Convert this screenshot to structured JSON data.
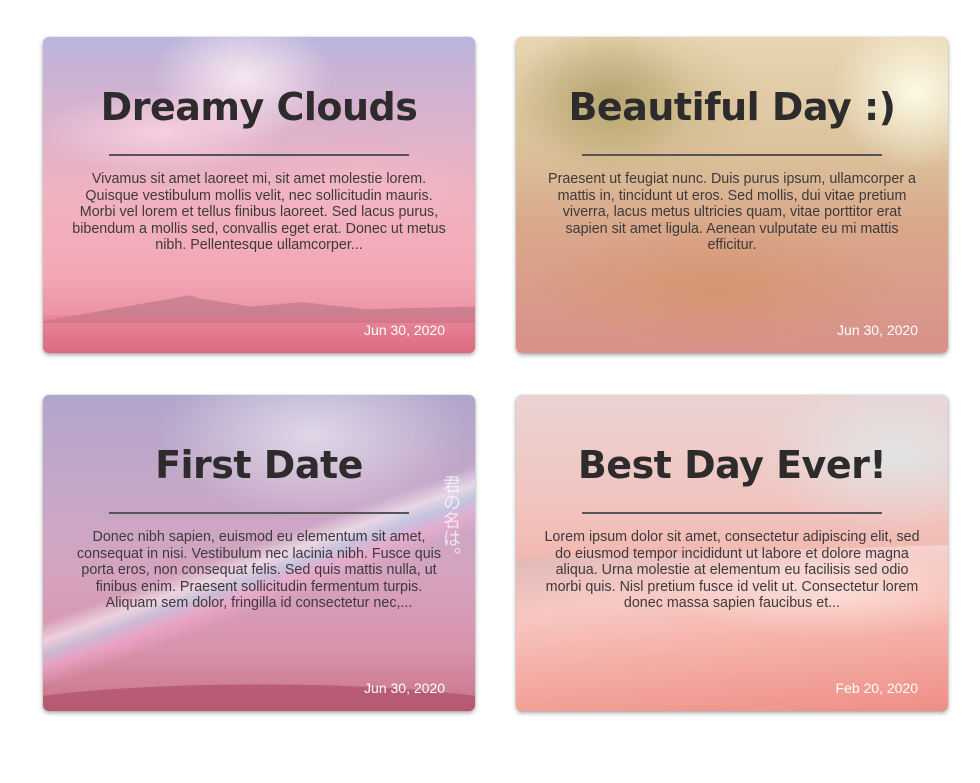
{
  "cards": [
    {
      "title": "Dreamy Clouds",
      "excerpt": "Vivamus sit amet laoreet mi, sit amet molestie lorem. Quisque vestibulum mollis velit, nec sollicitudin mauris. Morbi vel lorem et tellus finibus laoreet. Sed lacus purus, bibendum a mollis sed, convallis eget erat. Donec ut metus nibh. Pellentesque ullamcorper...",
      "date": "Jun 30, 2020"
    },
    {
      "title": "Beautiful Day :)",
      "excerpt": "Praesent ut feugiat nunc. Duis purus ipsum, ullamcorper a mattis in, tincidunt ut eros. Sed mollis, dui vitae pretium viverra, lacus metus ultricies quam, vitae porttitor erat sapien sit amet ligula. Aenean vulputate eu mi mattis efficitur.",
      "date": "Jun 30, 2020"
    },
    {
      "title": "First Date",
      "excerpt": "Donec nibh sapien, euismod eu elementum sit amet, consequat in nisi. Vestibulum nec lacinia nibh. Fusce quis porta eros, non consequat felis. Sed quis mattis nulla, ut finibus enim. Praesent sollicitudin fermentum turpis. Aliquam sem dolor, fringilla id consectetur nec,...",
      "date": "Jun 30, 2020",
      "image_text": "君の名は。"
    },
    {
      "title": "Best Day Ever!",
      "excerpt": "Lorem ipsum dolor sit amet, consectetur adipiscing elit, sed do eiusmod tempor incididunt ut labore et dolore magna aliqua. Urna molestie at elementum eu facilisis sed odio morbi quis. Nisl pretium fusce id velit ut. Consectetur lorem donec massa sapien faucibus et...",
      "date": "Feb 20, 2020"
    }
  ]
}
